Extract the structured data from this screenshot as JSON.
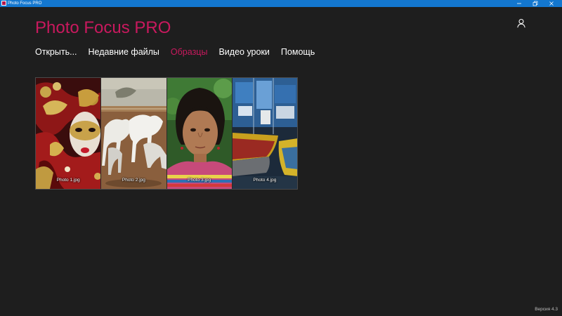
{
  "window": {
    "title": "Photo Focus PRO",
    "icon": "app-icon",
    "controls": [
      "minimize-icon",
      "restore-icon",
      "close-icon"
    ]
  },
  "header": {
    "title": "Photo Focus PRO",
    "user_icon": "user-icon"
  },
  "nav": {
    "items": [
      {
        "label": "Открыть..."
      },
      {
        "label": "Недавние файлы"
      },
      {
        "label": "Образцы",
        "active": true
      },
      {
        "label": "Видео уроки"
      },
      {
        "label": "Помощь"
      }
    ]
  },
  "samples": [
    {
      "label": "Photo 1.jpg"
    },
    {
      "label": "Photo 2.jpg"
    },
    {
      "label": "Photo 3.jpg"
    },
    {
      "label": "Photo 4.jpg"
    }
  ],
  "footer": {
    "version": "Версия 4.3"
  },
  "colors": {
    "accent": "#c9195e",
    "titlebar": "#1377cf",
    "background": "#1e1e1e"
  }
}
